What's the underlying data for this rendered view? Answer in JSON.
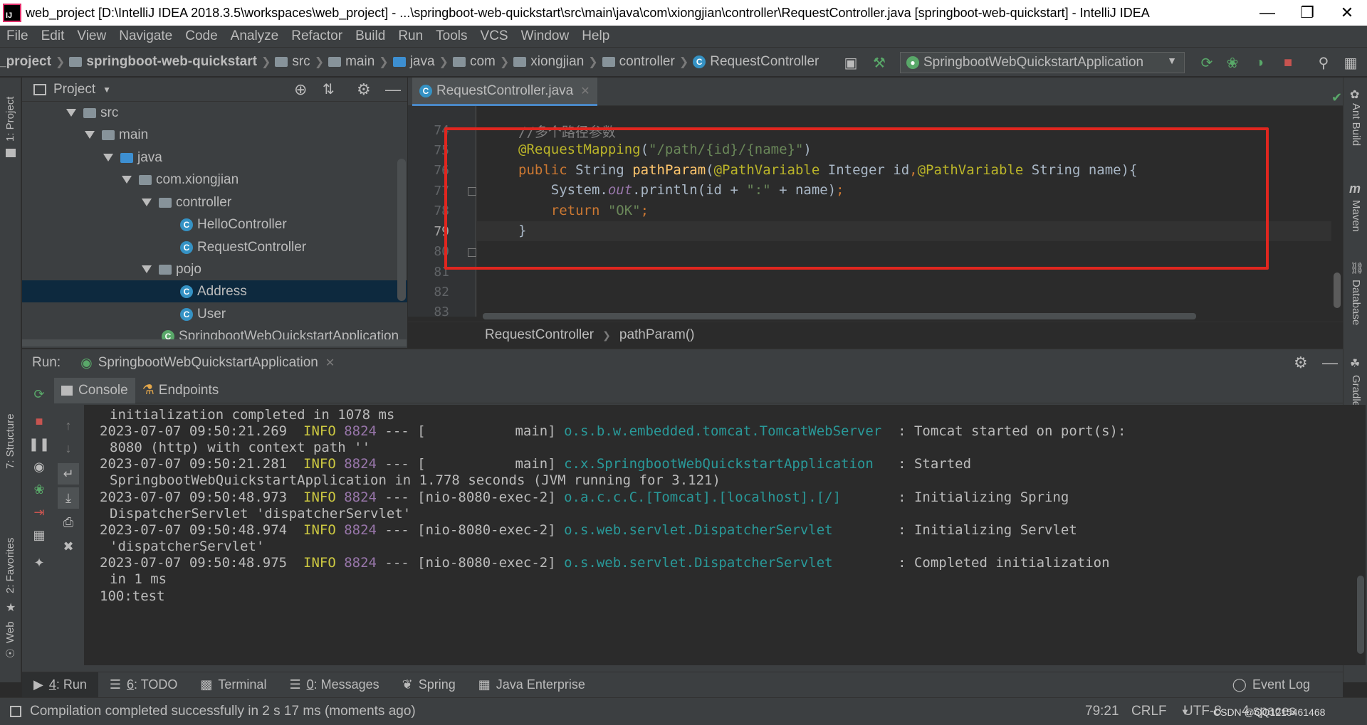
{
  "window": {
    "title": "web_project [D:\\IntelliJ IDEA 2018.3.5\\workspaces\\web_project] - ...\\springboot-web-quickstart\\src\\main\\java\\com\\xiongjian\\controller\\RequestController.java [springboot-web-quickstart] - IntelliJ IDEA",
    "logo_text": "IJ"
  },
  "menu": [
    "File",
    "Edit",
    "View",
    "Navigate",
    "Code",
    "Analyze",
    "Refactor",
    "Build",
    "Run",
    "Tools",
    "VCS",
    "Window",
    "Help"
  ],
  "breadcrumbs": [
    "_project",
    "springboot-web-quickstart",
    "src",
    "main",
    "java",
    "com",
    "xiongjian",
    "controller",
    "RequestController"
  ],
  "run_config": "SpringbootWebQuickstartApplication",
  "project_panel": {
    "title": "Project",
    "tree": [
      {
        "label": "src",
        "kind": "folder"
      },
      {
        "label": "main",
        "kind": "folder"
      },
      {
        "label": "java",
        "kind": "folder-blue"
      },
      {
        "label": "com.xiongjian",
        "kind": "package"
      },
      {
        "label": "controller",
        "kind": "package"
      },
      {
        "label": "HelloController",
        "kind": "class"
      },
      {
        "label": "RequestController",
        "kind": "class"
      },
      {
        "label": "pojo",
        "kind": "package"
      },
      {
        "label": "Address",
        "kind": "class"
      },
      {
        "label": "User",
        "kind": "class"
      },
      {
        "label": "SpringbootWebQuickstartApplication",
        "kind": "class"
      }
    ]
  },
  "editor": {
    "tab": "RequestController.java",
    "line_numbers": [
      "74",
      "75",
      "76",
      "77",
      "78",
      "79",
      "80",
      "81",
      "82",
      "83"
    ],
    "code": {
      "l75_comment": "//多个路径参数",
      "l76_ann": "@RequestMapping",
      "l76_str": "\"/path/{id}/{name}\"",
      "l77_kw": "public",
      "l77_type": "String",
      "l77_fn": "pathParam",
      "l77_ann1": "@PathVariable",
      "l77_mid": "Integer id",
      "l77_ann2": "@PathVariable",
      "l77_end": "String name){",
      "l78_a": "System.",
      "l78_out": "out",
      "l78_b": ".println(id + ",
      "l78_str": "\":\"",
      "l78_c": " + name)",
      "l78_semi": ";",
      "l79_kw": "return",
      "l79_str": "\"OK\"",
      "l80": "}"
    },
    "breadcrumb": [
      "RequestController",
      "pathParam()"
    ]
  },
  "run_panel": {
    "label": "Run:",
    "config_tab": "SpringbootWebQuickstartApplication",
    "tabs": [
      "Console",
      "Endpoints"
    ],
    "console": {
      "l0": "initialization completed in 1078 ms",
      "r1": {
        "ts": "2023-07-07 09:50:21.269",
        "level": "INFO",
        "pid": "8824",
        "thread": " --- [           main] ",
        "logger": "o.s.b.w.embedded.tomcat.TomcatWebServer",
        "msg": "  : Tomcat started on port(s):",
        "cont": "8080 (http) with context path ''"
      },
      "r2": {
        "ts": "2023-07-07 09:50:21.281",
        "level": "INFO",
        "pid": "8824",
        "thread": " --- [           main] ",
        "logger": "c.x.SpringbootWebQuickstartApplication",
        "msg": "   : Started",
        "cont": "SpringbootWebQuickstartApplication in 1.778 seconds (JVM running for 3.121)"
      },
      "r3": {
        "ts": "2023-07-07 09:50:48.973",
        "level": "INFO",
        "pid": "8824",
        "thread": " --- [nio-8080-exec-2] ",
        "logger": "o.a.c.c.C.[Tomcat].[localhost].[/]",
        "msg": "       : Initializing Spring",
        "cont": "DispatcherServlet 'dispatcherServlet'"
      },
      "r4": {
        "ts": "2023-07-07 09:50:48.974",
        "level": "INFO",
        "pid": "8824",
        "thread": " --- [nio-8080-exec-2] ",
        "logger": "o.s.web.servlet.DispatcherServlet",
        "msg": "        : Initializing Servlet",
        "cont": "'dispatcherServlet'"
      },
      "r5": {
        "ts": "2023-07-07 09:50:48.975",
        "level": "INFO",
        "pid": "8824",
        "thread": " --- [nio-8080-exec-2] ",
        "logger": "o.s.web.servlet.DispatcherServlet",
        "msg": "        : Completed initialization",
        "cont": "in 1 ms"
      },
      "last": "100:test"
    }
  },
  "left_stripe": [
    "1: Project",
    "7: Structure",
    "2: Favorites",
    "Web"
  ],
  "right_stripe": [
    "Ant Build",
    "Maven",
    "Database",
    "Gradle"
  ],
  "tool_tabs": [
    {
      "num": "4",
      "label": ": Run"
    },
    {
      "num": "6",
      "label": ": TODO"
    },
    {
      "num": "",
      "label": "Terminal"
    },
    {
      "num": "0",
      "label": ": Messages"
    },
    {
      "num": "",
      "label": "Spring"
    },
    {
      "num": "",
      "label": "Java Enterprise"
    }
  ],
  "event_log": "Event Log",
  "status": {
    "message": "Compilation completed successfully in 2 s 17 ms (moments ago)",
    "position": "79:21",
    "line_sep": "CRLF",
    "encoding": "UTF-8",
    "indent": "4 spaces",
    "watermark": "CSDN @QQ1215461468"
  }
}
